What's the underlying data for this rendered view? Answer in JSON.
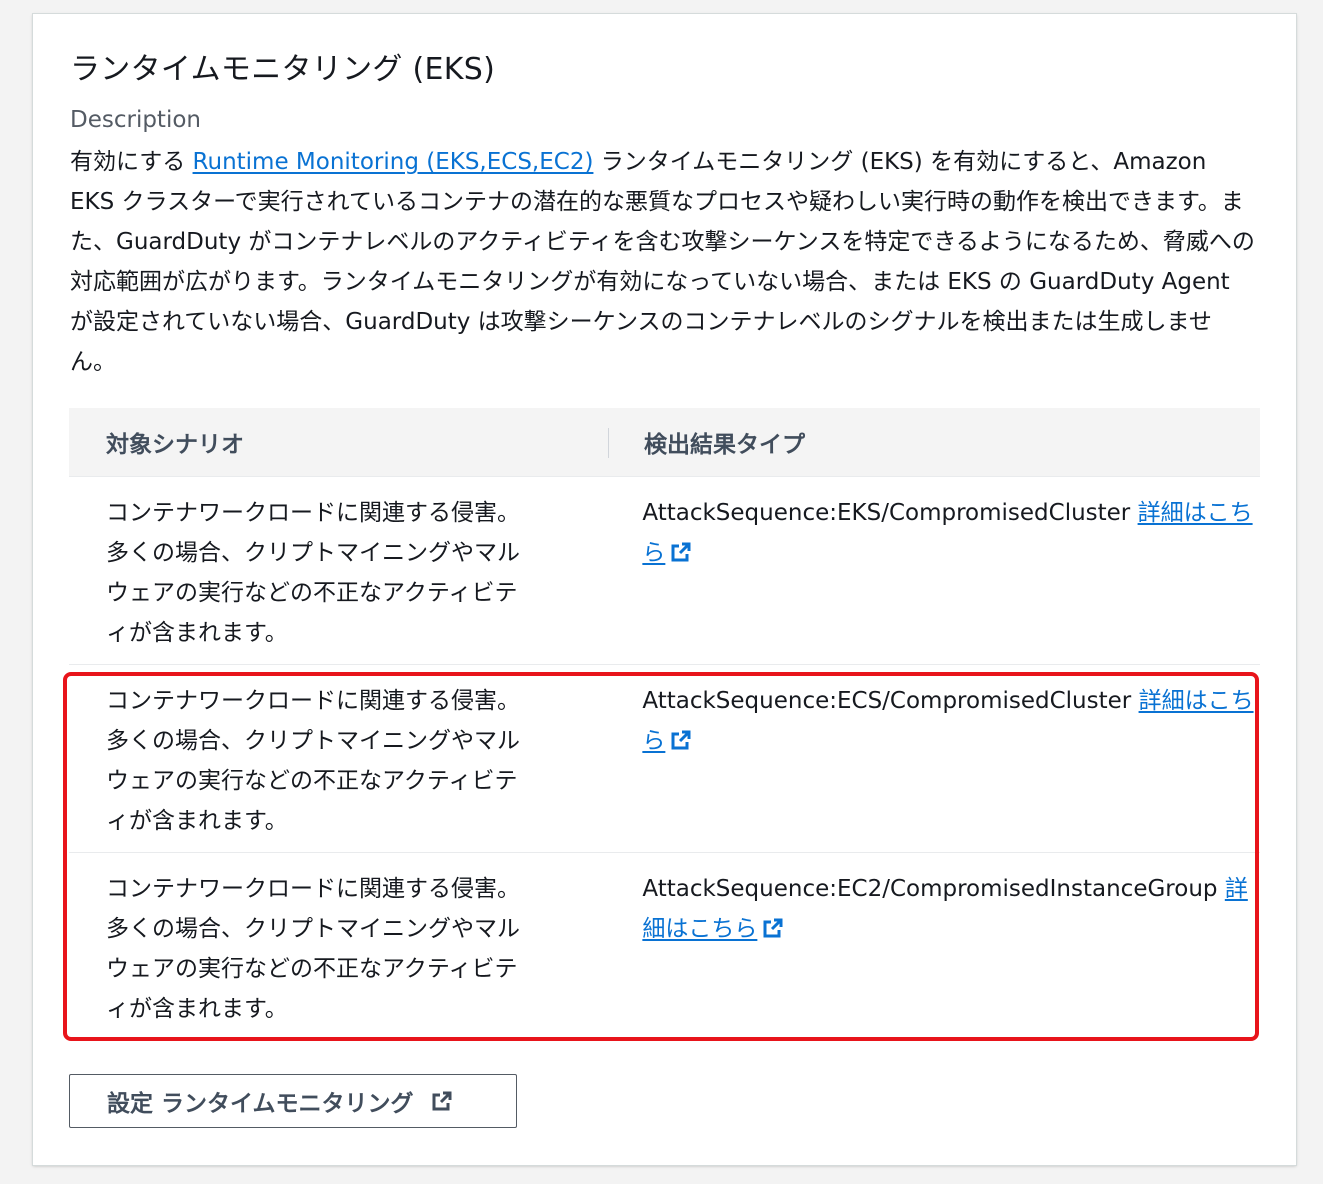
{
  "panel": {
    "title": "ランタイムモニタリング (EKS)",
    "description_label": "Description",
    "description": {
      "prefix": "有効にする ",
      "link_text": "Runtime Monitoring (EKS,ECS,EC2)",
      "suffix": " ランタイムモニタリング (EKS) を有効にすると、Amazon EKS クラスターで実行されているコンテナの潜在的な悪質なプロセスや疑わしい実行時の動作を検出できます。また、GuardDuty がコンテナレベルのアクティビティを含む攻撃シーケンスを特定できるようになるため、脅威への対応範囲が広がります。ランタイムモニタリングが有効になっていない場合、または EKS の GuardDuty Agent が設定されていない場合、GuardDuty は攻撃シーケンスのコンテナレベルのシグナルを検出または生成しません。"
    }
  },
  "table": {
    "headers": [
      "対象シナリオ",
      "検出結果タイプ"
    ],
    "rows": [
      {
        "scenario": "コンテナワークロードに関連する侵害。多くの場合、クリプトマイニングやマルウェアの実行などの不正なアクティビティが含まれます。",
        "finding_type": "AttackSequence:EKS/CompromisedCluster",
        "link_text": "詳細はこちら"
      },
      {
        "scenario": "コンテナワークロードに関連する侵害。多くの場合、クリプトマイニングやマルウェアの実行などの不正なアクティビティが含まれます。",
        "finding_type": "AttackSequence:ECS/CompromisedCluster",
        "link_text": "詳細はこちら"
      },
      {
        "scenario": "コンテナワークロードに関連する侵害。多くの場合、クリプトマイニングやマルウェアの実行などの不正なアクティビティが含まれます。",
        "finding_type": "AttackSequence:EC2/CompromisedInstanceGroup",
        "link_text": "詳細はこちら"
      }
    ]
  },
  "config_button": {
    "label": "設定 ランタイムモニタリング",
    "icon": "external-link-icon"
  },
  "colors": {
    "link": "#0972d3",
    "highlight_border": "#e8141b",
    "header_bg": "#f4f4f4"
  }
}
